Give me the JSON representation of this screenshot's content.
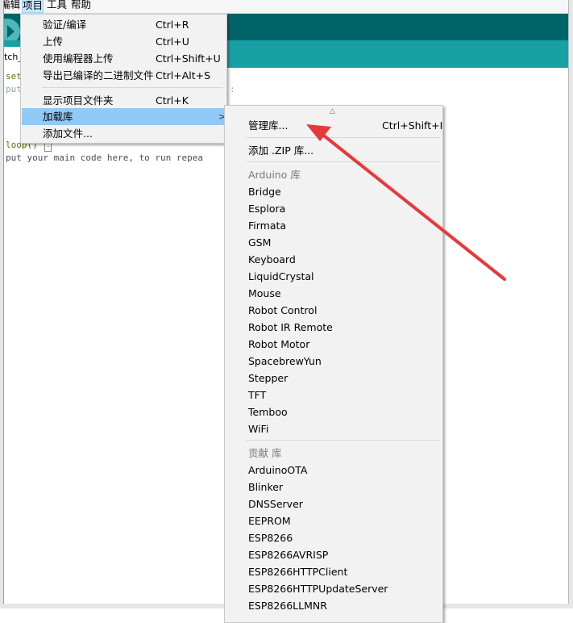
{
  "menubar": {
    "items": [
      {
        "label": "编辑"
      },
      {
        "label": "项目"
      },
      {
        "label": "工具"
      },
      {
        "label": "帮助"
      }
    ]
  },
  "tab": {
    "label": "tch_"
  },
  "code": {
    "line1": "set",
    "line2": "put",
    "line2_tail": ":",
    "line3": "loop() ",
    "line4": "put your main code here, to run repea"
  },
  "project_menu": {
    "items": [
      {
        "label": "验证/编译",
        "shortcut": "Ctrl+R"
      },
      {
        "label": "上传",
        "shortcut": "Ctrl+U"
      },
      {
        "label": "使用编程器上传",
        "shortcut": "Ctrl+Shift+U"
      },
      {
        "label": "导出已编译的二进制文件",
        "shortcut": "Ctrl+Alt+S"
      },
      {
        "label": "显示项目文件夹",
        "shortcut": "Ctrl+K"
      },
      {
        "label": "加载库",
        "shortcut": ""
      },
      {
        "label": "添加文件...",
        "shortcut": ""
      }
    ],
    "submenu_arrow": ">"
  },
  "library_menu": {
    "scroll_up": "△",
    "manage": {
      "label": "管理库...",
      "shortcut": "Ctrl+Shift+I"
    },
    "add_zip": {
      "label": "添加 .ZIP 库..."
    },
    "arduino_header": "Arduino 库",
    "arduino_libs": [
      "Bridge",
      "Esplora",
      "Firmata",
      "GSM",
      "Keyboard",
      "LiquidCrystal",
      "Mouse",
      "Robot Control",
      "Robot IR Remote",
      "Robot Motor",
      "SpacebrewYun",
      "Stepper",
      "TFT",
      "Temboo",
      "WiFi"
    ],
    "contrib_header": "贡献 库",
    "contrib_libs": [
      "ArduinoOTA",
      "Blinker",
      "DNSServer",
      "EEPROM",
      "ESP8266",
      "ESP8266AVRISP",
      "ESP8266HTTPClient",
      "ESP8266HTTPUpdateServer",
      "ESP8266LLMNR"
    ]
  },
  "colors": {
    "toolbar": "#006468",
    "tabbar": "#17a1a5",
    "menu_highlight": "#91c9f7",
    "annotation_arrow": "#e8393a"
  }
}
